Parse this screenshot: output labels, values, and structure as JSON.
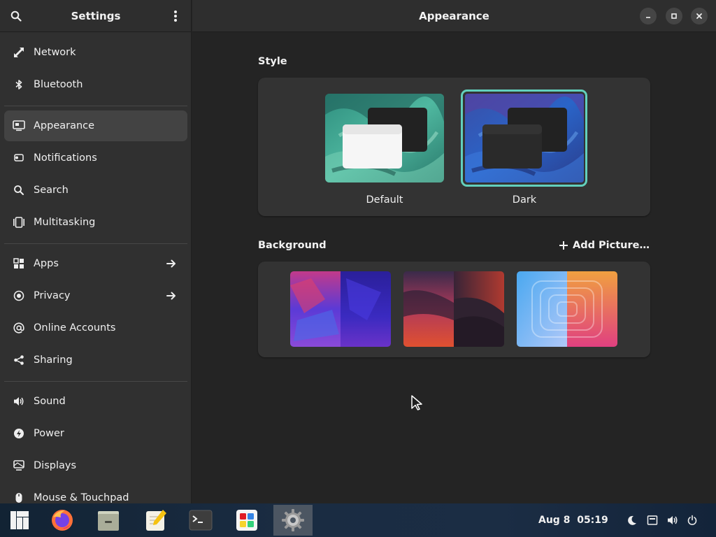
{
  "sidebar": {
    "title": "Settings",
    "items": [
      {
        "label": "Network",
        "icon": "network-icon"
      },
      {
        "label": "Bluetooth",
        "icon": "bluetooth-icon"
      },
      {
        "label": "Appearance",
        "icon": "appearance-icon",
        "active": true
      },
      {
        "label": "Notifications",
        "icon": "notifications-icon"
      },
      {
        "label": "Search",
        "icon": "search-icon"
      },
      {
        "label": "Multitasking",
        "icon": "multitasking-icon"
      },
      {
        "label": "Apps",
        "icon": "apps-icon",
        "arrow": true
      },
      {
        "label": "Privacy",
        "icon": "privacy-icon",
        "arrow": true
      },
      {
        "label": "Online Accounts",
        "icon": "online-accounts-icon"
      },
      {
        "label": "Sharing",
        "icon": "sharing-icon"
      },
      {
        "label": "Sound",
        "icon": "sound-icon"
      },
      {
        "label": "Power",
        "icon": "power-icon"
      },
      {
        "label": "Displays",
        "icon": "displays-icon"
      },
      {
        "label": "Mouse & Touchpad",
        "icon": "mouse-icon"
      }
    ]
  },
  "main": {
    "title": "Appearance",
    "style": {
      "label": "Style",
      "options": [
        {
          "label": "Default",
          "selected": false
        },
        {
          "label": "Dark",
          "selected": true
        }
      ]
    },
    "background": {
      "label": "Background",
      "add_label": "Add Picture…"
    }
  },
  "taskbar": {
    "date": "Aug 8",
    "time": "05:19",
    "apps": [
      "manjaro-icon",
      "firefox-icon",
      "files-icon",
      "text-editor-icon",
      "terminal-icon",
      "software-icon",
      "settings-icon"
    ]
  },
  "colors": {
    "accent": "#62d0bd",
    "window_bg": "#242424",
    "sidebar_bg": "#303030",
    "card_bg": "#333333"
  }
}
